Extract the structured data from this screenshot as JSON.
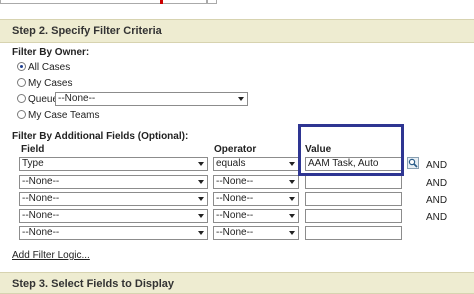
{
  "step2": {
    "title": "Step 2. Specify Filter Criteria",
    "owner_heading": "Filter By Owner:",
    "owner_options": [
      {
        "label": "All Cases",
        "selected": true
      },
      {
        "label": "My Cases",
        "selected": false
      },
      {
        "label": "Queue",
        "selected": false
      },
      {
        "label": "My Case Teams",
        "selected": false
      }
    ],
    "queue_select": "--None--",
    "additional_heading": "Filter By Additional Fields (Optional):",
    "columns": {
      "field": "Field",
      "operator": "Operator",
      "value": "Value"
    },
    "rows": [
      {
        "field": "Type",
        "operator": "equals",
        "value": "AAM Task, Auto",
        "connector": "AND"
      },
      {
        "field": "--None--",
        "operator": "--None--",
        "value": "",
        "connector": "AND"
      },
      {
        "field": "--None--",
        "operator": "--None--",
        "value": "",
        "connector": "AND"
      },
      {
        "field": "--None--",
        "operator": "--None--",
        "value": "",
        "connector": "AND"
      },
      {
        "field": "--None--",
        "operator": "--None--",
        "value": "",
        "connector": ""
      }
    ],
    "add_filter_logic": "Add Filter Logic..."
  },
  "step3": {
    "title": "Step 3. Select Fields to Display"
  },
  "colors": {
    "header_bg": "#eeecd1",
    "highlight_border": "#2e3592",
    "required_marker": "#cc0000"
  },
  "icons": {
    "lookup": "magnifier-lookup-icon"
  }
}
